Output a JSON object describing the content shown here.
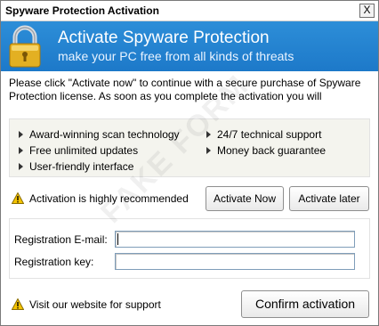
{
  "window": {
    "title": "Spyware Protection Activation",
    "close_label": "X"
  },
  "banner": {
    "title": "Activate Spyware Protection",
    "subtitle": "make your PC free from all kinds of threats"
  },
  "description": "Please click \"Activate now\" to continue with a secure purchase of Spyware Protection license. As soon as you complete the activation you will",
  "features": {
    "left": [
      "Award-winning scan technology",
      "Free unlimited updates",
      "User-friendly interface"
    ],
    "right": [
      "24/7 technical support",
      "Money back guarantee"
    ]
  },
  "recommendation": {
    "text": "Activation is highly recommended",
    "activate_now_label": "Activate Now",
    "activate_later_label": "Activate later"
  },
  "registration": {
    "email_label": "Registration E-mail:",
    "email_value": "",
    "key_label": "Registration key:",
    "key_value": ""
  },
  "footer": {
    "support_text": "Visit our website for support",
    "confirm_label": "Confirm activation"
  },
  "watermark": "FAKE FORM",
  "colors": {
    "banner": "#1d79c9",
    "warning": "#f5c400",
    "field_border": "#7f9db9"
  }
}
